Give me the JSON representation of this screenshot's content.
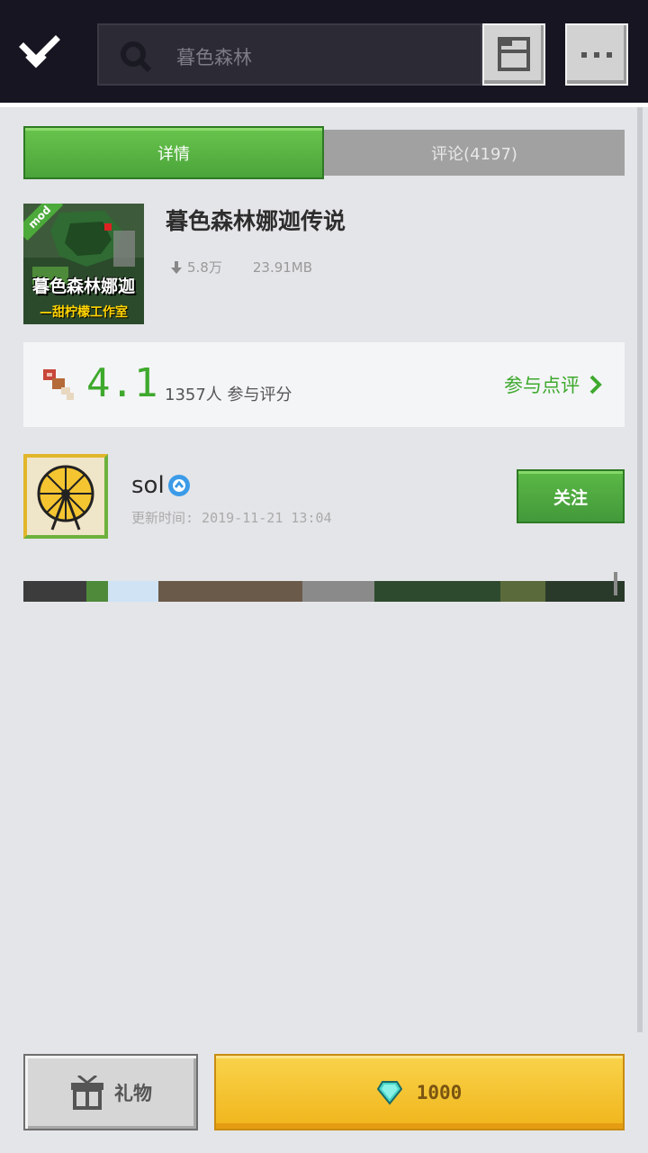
{
  "header": {
    "search_value": "暮色森林"
  },
  "tabs": [
    {
      "label": "详情",
      "active": true
    },
    {
      "label": "评论(4197)",
      "active": false
    }
  ],
  "item": {
    "thumb_title": "暮色森林娜迦",
    "thumb_sub": "—甜柠檬工作室",
    "thumb_badge": "mod",
    "title": "暮色森林娜迦传说",
    "downloads": "5.8万",
    "size": "23.91MB"
  },
  "rating": {
    "score": "4.1",
    "count_text": "1357人 参与评分",
    "rate_link": "参与点评"
  },
  "author": {
    "name": "sol",
    "update_time": "更新时间: 2019-11-21 13:04",
    "follow_label": "关注"
  },
  "bottom": {
    "gift_label": "礼物",
    "price": "1000"
  },
  "colors": {
    "accent_green": "#3ea92d",
    "top_bar": "#161521",
    "gold": "#f0b51b"
  }
}
